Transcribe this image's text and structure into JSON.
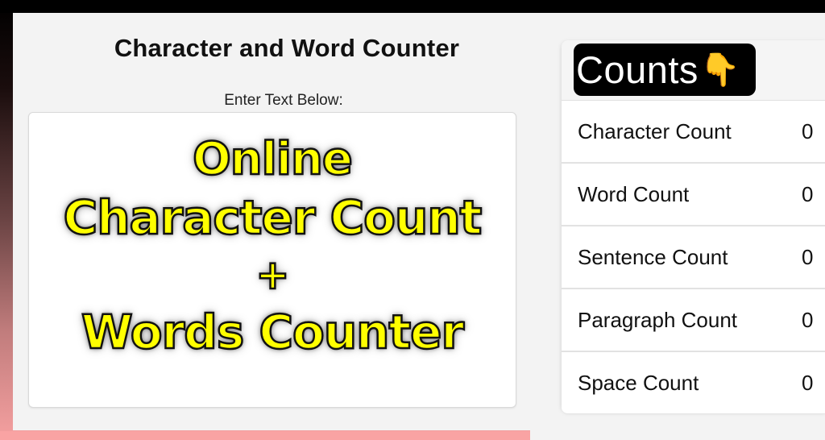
{
  "app": {
    "title": "Character and Word Counter",
    "input_label": "Enter Text Below:",
    "input_overlay_lines": [
      "Online",
      "Character Count",
      "+",
      "Words Counter"
    ],
    "input_value": ""
  },
  "counts": {
    "header_title": "Counts",
    "header_icon": "👇",
    "rows": [
      {
        "label": "Character Count",
        "value": "0"
      },
      {
        "label": "Word Count",
        "value": "0"
      },
      {
        "label": "Sentence Count",
        "value": "0"
      },
      {
        "label": "Paragraph Count",
        "value": "0"
      },
      {
        "label": "Space Count",
        "value": "0"
      }
    ]
  },
  "colors": {
    "overlay_text": "#ffff00",
    "header_bg": "#000000",
    "bottom_band": "#f9a3a3"
  }
}
